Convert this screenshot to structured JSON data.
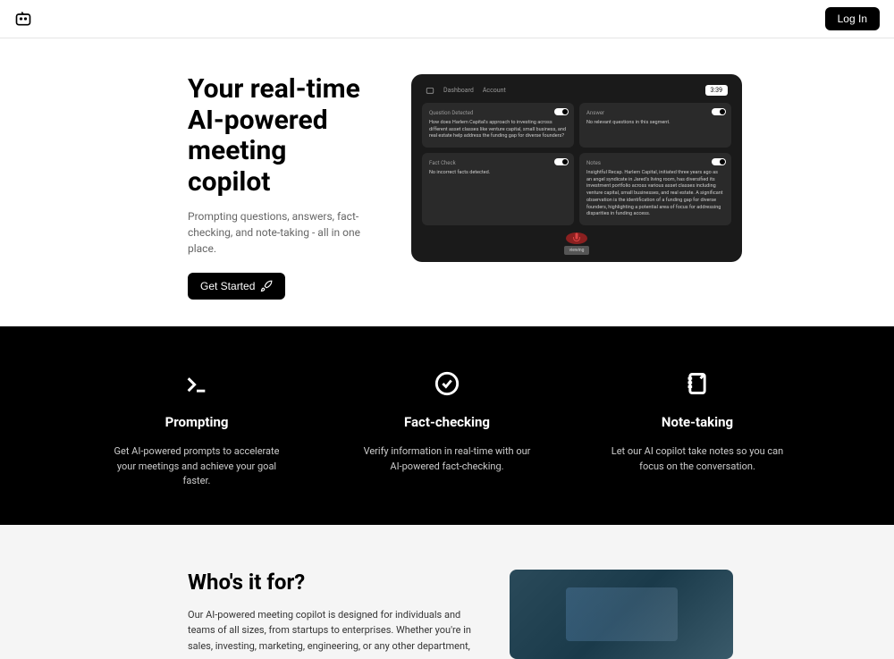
{
  "header": {
    "login_label": "Log In"
  },
  "hero": {
    "title": "Your real-time AI-powered meeting copilot",
    "subtitle": "Prompting questions, answers, fact-checking, and note-taking - all in one place.",
    "cta_label": "Get Started"
  },
  "screenshot": {
    "tabs": [
      "Dashboard",
      "Account"
    ],
    "timer": "3:39",
    "cards": [
      {
        "title": "Question Detected",
        "text": "How does Harlem Capital's approach to investing across different asset classes like venture capital, small business, and real estate help address the funding gap for diverse founders?"
      },
      {
        "title": "Answer",
        "text": "No relevant questions in this segment."
      },
      {
        "title": "Fact Check",
        "text": "No incorrect facts detected."
      },
      {
        "title": "Notes",
        "text": "Insightful Recap. Harlem Capital, initiated three years ago as an angel syndicate in Jared's living room, has diversified its investment portfolio across various asset classes including venture capital, small businesses, and real estate. A significant observation is the identification of a funding gap for diverse founders, highlighting a potential area of focus for addressing disparities in funding access."
      }
    ],
    "footer": "viewing"
  },
  "features": [
    {
      "title": "Prompting",
      "desc": "Get AI-powered prompts to accelerate your meetings and achieve your goal faster."
    },
    {
      "title": "Fact-checking",
      "desc": "Verify information in real-time with our AI-powered fact-checking."
    },
    {
      "title": "Note-taking",
      "desc": "Let our AI copilot take notes so you can focus on the conversation."
    }
  ],
  "who_for": {
    "title": "Who's it for?",
    "desc": "Our AI-powered meeting copilot is designed for individuals and teams of all sizes, from startups to enterprises. Whether you're in sales, investing, marketing, engineering, or any other department,"
  }
}
